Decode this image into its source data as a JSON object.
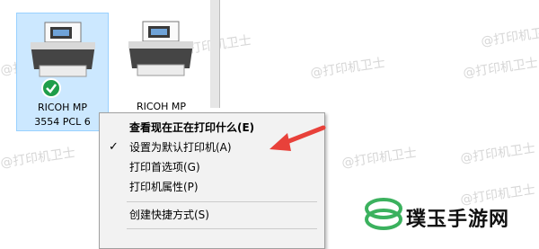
{
  "printers": [
    {
      "name_line1": "RICOH MP",
      "name_line2": "3554 PCL 6",
      "selected": true,
      "default": true
    },
    {
      "name_line1": "RICOH MP",
      "name_line2": "",
      "selected": false,
      "default": false
    }
  ],
  "context_menu": {
    "items": [
      {
        "label": "查看现在正在打印什么(E)",
        "bold": true,
        "checked": false
      },
      {
        "label": "设置为默认打印机(A)",
        "bold": false,
        "checked": true
      },
      {
        "label": "打印首选项(G)",
        "bold": false,
        "checked": false
      },
      {
        "label": "打印机属性(P)",
        "bold": false,
        "checked": false
      },
      {
        "label": "创建快捷方式(S)",
        "bold": false,
        "checked": false
      }
    ]
  },
  "watermark": {
    "text": "@打印机卫士"
  },
  "logo": {
    "text": "璞玉手游网"
  },
  "colors": {
    "selection": "#cce8ff",
    "arrow": "#e8413a",
    "check_badge": "#1f9e4a",
    "logo_green": "#3bb15e"
  }
}
